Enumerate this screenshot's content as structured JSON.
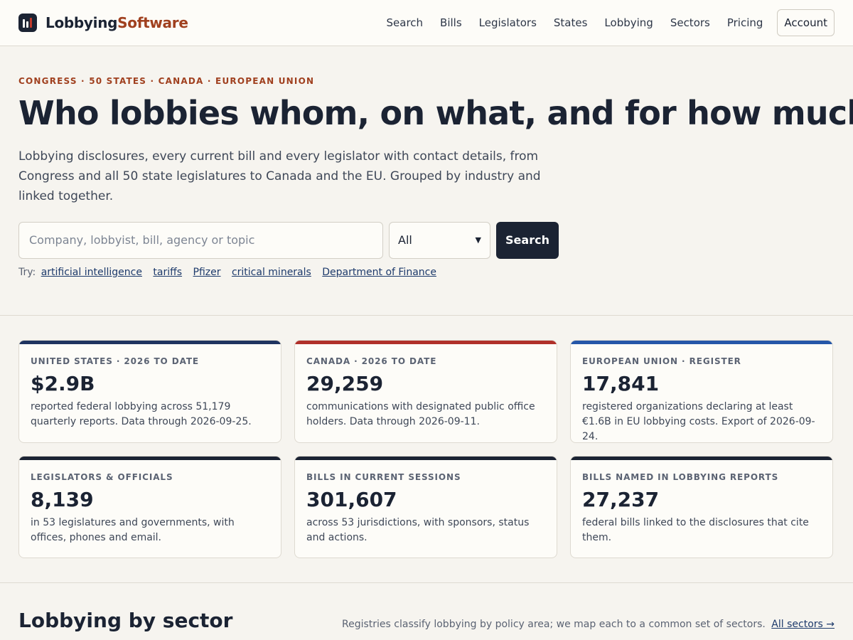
{
  "header": {
    "logo_part1": "Lobbying",
    "logo_part2": "Software",
    "nav": [
      "Search",
      "Bills",
      "Legislators",
      "States",
      "Lobbying",
      "Sectors",
      "Pricing"
    ],
    "account_label": "Account"
  },
  "hero": {
    "eyebrow": "CONGRESS · 50 STATES · CANADA · EUROPEAN UNION",
    "title": "Who lobbies whom, on what, and for how much.",
    "description": "Lobbying disclosures, every current bill and every legislator with contact details, from Congress and all 50 state legislatures to Canada and the EU. Grouped by industry and linked together.",
    "search_placeholder": "Company, lobbyist, bill, agency or topic",
    "select_value": "All",
    "search_button": "Search",
    "try_label": "Try:",
    "try_links": [
      "artificial intelligence",
      "tariffs",
      "Pfizer",
      "critical minerals",
      "Department of Finance"
    ]
  },
  "stats": [
    {
      "label": "UNITED STATES · 2026 TO DATE",
      "value": "$2.9B",
      "desc": "reported federal lobbying across 51,179 quarterly reports. Data through 2026-09-25.",
      "accent": "#1f3460"
    },
    {
      "label": "CANADA · 2026 TO DATE",
      "value": "29,259",
      "desc": "communications with designated public office holders. Data through 2026-09-11.",
      "accent": "#b0302a"
    },
    {
      "label": "EUROPEAN UNION · REGISTER",
      "value": "17,841",
      "desc": "registered organizations declaring at least €1.6B in EU lobbying costs. Export of 2026-09-24.",
      "accent": "#2557a8"
    },
    {
      "label": "LEGISLATORS & OFFICIALS",
      "value": "8,139",
      "desc": "in 53 legislatures and governments, with offices, phones and email.",
      "accent": "#1b2333"
    },
    {
      "label": "BILLS IN CURRENT SESSIONS",
      "value": "301,607",
      "desc": "across 53 jurisdictions, with sponsors, status and actions.",
      "accent": "#1b2333"
    },
    {
      "label": "BILLS NAMED IN LOBBYING REPORTS",
      "value": "27,237",
      "desc": "federal bills linked to the disclosures that cite them.",
      "accent": "#1b2333"
    }
  ],
  "sector": {
    "title": "Lobbying by sector",
    "note": "Registries classify lobbying by policy area; we map each to a common set of sectors.",
    "link": "All sectors →"
  }
}
